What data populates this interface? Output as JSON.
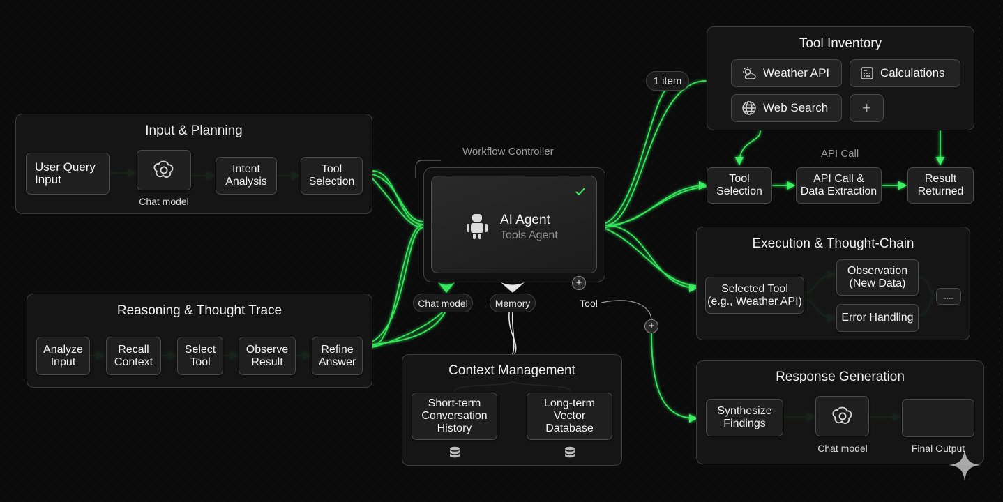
{
  "input_planning": {
    "title": "Input & Planning",
    "nodes": [
      "User Query\nInput",
      "Intent\nAnalysis",
      "Tool\nSelection"
    ],
    "chat_caption": "Chat model",
    "chat_icon": "openai-logo-icon"
  },
  "reasoning": {
    "title": "Reasoning & Thought Trace",
    "nodes": [
      "Analyze\nInput",
      "Recall\nContext",
      "Select\nTool",
      "Observe\nResult",
      "Refine\nAnswer"
    ]
  },
  "agent": {
    "controller_label": "Workflow Controller",
    "name": "AI Agent",
    "subtitle": "Tools Agent",
    "icon": "robot-icon",
    "status_icon": "check-icon",
    "ports": [
      "Chat model",
      "Memory",
      "Tool"
    ]
  },
  "context": {
    "title": "Context Management",
    "nodes": [
      "Short-term\nConversation\nHistory",
      "Long-term\nVector\nDatabase"
    ],
    "icon": "database-icon"
  },
  "tool_inventory": {
    "title": "Tool Inventory",
    "count_label": "1 item",
    "tools": [
      {
        "label": "Weather API",
        "icon": "weather-icon"
      },
      {
        "label": "Calculations",
        "icon": "calculator-icon"
      },
      {
        "label": "Web Search",
        "icon": "globe-icon"
      }
    ],
    "add_icon": "plus-icon"
  },
  "api_flow": {
    "label": "API Call",
    "nodes": [
      "Tool\nSelection",
      "API Call &\nData Extraction",
      "Result\nReturned"
    ]
  },
  "execution": {
    "title": "Execution & Thought-Chain",
    "nodes": [
      "Selected Tool\n(e.g., Weather API)",
      "Observation\n(New Data)",
      "Error Handling"
    ],
    "more_label": "....",
    "more_icon": "ellipsis-icon"
  },
  "response": {
    "title": "Response Generation",
    "nodes": [
      "Synthesize\nFindings"
    ],
    "chat_caption": "Chat model",
    "output_caption": "Final Output",
    "chat_icon": "openai-logo-icon"
  },
  "colors": {
    "accent": "#39e75f",
    "panel_border": "#3c3c3c",
    "background": "#0b0b0b"
  }
}
